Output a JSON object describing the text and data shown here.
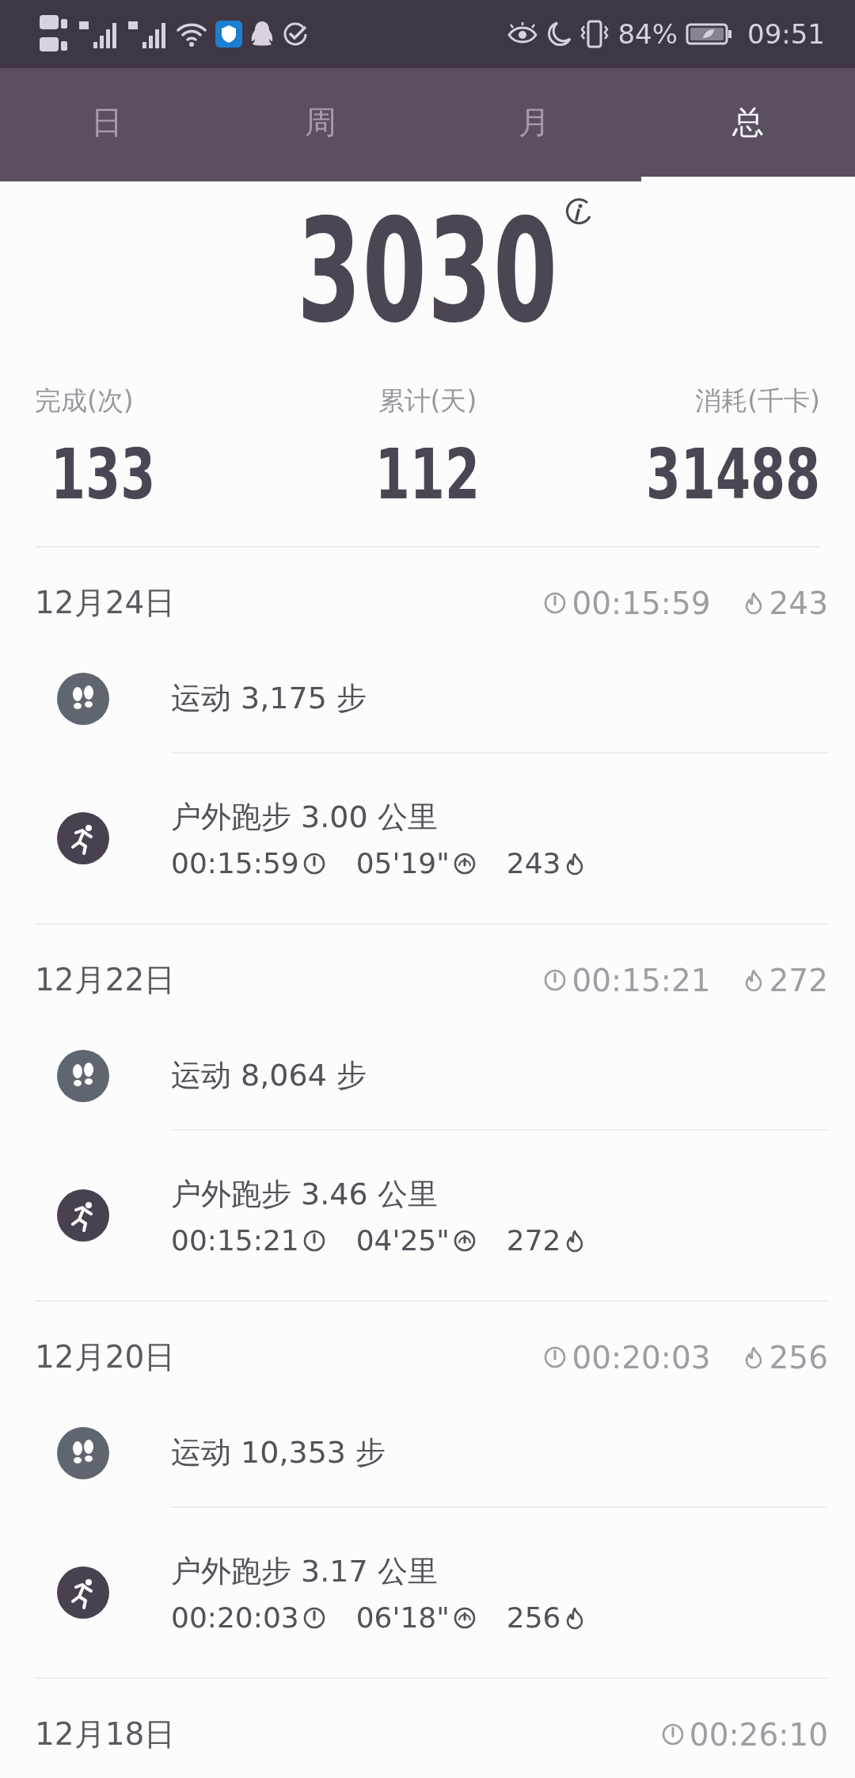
{
  "status_bar": {
    "battery": "84%",
    "time": "09:51"
  },
  "tabs": [
    {
      "label": "日",
      "selected": false
    },
    {
      "label": "周",
      "selected": false
    },
    {
      "label": "月",
      "selected": false
    },
    {
      "label": "总",
      "selected": true
    }
  ],
  "summary": {
    "total": "3030",
    "stats": [
      {
        "label": "完成(次)",
        "value": "133"
      },
      {
        "label": "累计(天)",
        "value": "112"
      },
      {
        "label": "消耗(千卡)",
        "value": "31488"
      }
    ]
  },
  "days": [
    {
      "date": "12月24日",
      "duration": "00:15:59",
      "calories": "243",
      "activities": [
        {
          "kind": "steps",
          "title": "运动 3,175 步"
        },
        {
          "kind": "run",
          "title": "户外跑步 3.00 公里",
          "duration": "00:15:59",
          "pace": "05'19\"",
          "calories": "243"
        }
      ]
    },
    {
      "date": "12月22日",
      "duration": "00:15:21",
      "calories": "272",
      "activities": [
        {
          "kind": "steps",
          "title": "运动 8,064 步"
        },
        {
          "kind": "run",
          "title": "户外跑步 3.46 公里",
          "duration": "00:15:21",
          "pace": "04'25\"",
          "calories": "272"
        }
      ]
    },
    {
      "date": "12月20日",
      "duration": "00:20:03",
      "calories": "256",
      "activities": [
        {
          "kind": "steps",
          "title": "运动 10,353 步"
        },
        {
          "kind": "run",
          "title": "户外跑步 3.17 公里",
          "duration": "00:20:03",
          "pace": "06'18\"",
          "calories": "256"
        }
      ]
    },
    {
      "date": "12月18日",
      "duration": "00:26:10"
    }
  ]
}
